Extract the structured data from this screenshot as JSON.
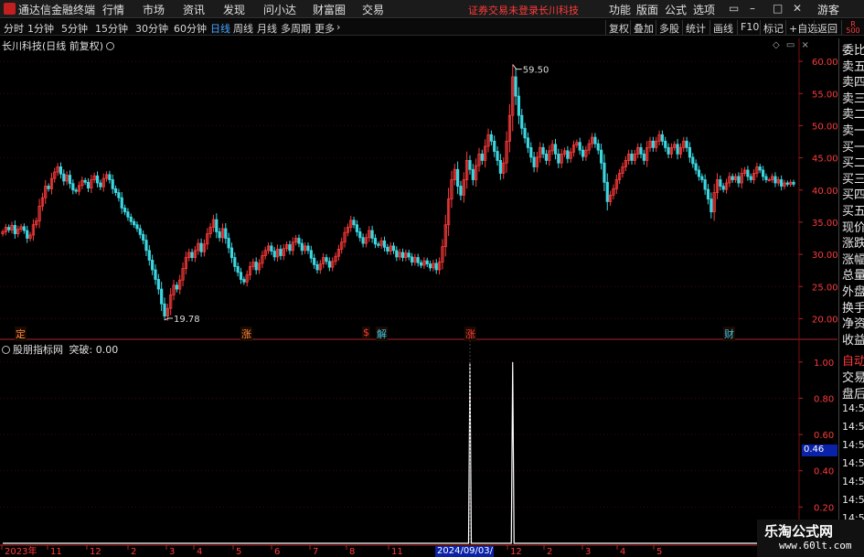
{
  "app": {
    "name": "通达信金融终端",
    "menus": [
      "行情",
      "市场",
      "资讯",
      "发现",
      "问小达",
      "财富圈",
      "交易"
    ],
    "notice": "证券交易未登录",
    "stock_name": "长川科技",
    "right_menus": [
      "功能",
      "版面",
      "公式",
      "选项"
    ],
    "user": "游客"
  },
  "toolbar": {
    "periods": [
      "分时",
      "1分钟",
      "5分钟",
      "15分钟",
      "30分钟",
      "60分钟",
      "日线",
      "周线",
      "月线",
      "多周期",
      "更多"
    ],
    "active_period": "日线",
    "buttons": [
      "复权",
      "叠加",
      "多股",
      "统计",
      "画线",
      "F10",
      "标记",
      "+自选",
      "返回"
    ],
    "r_badge_top": "R",
    "r_badge_bottom": "500"
  },
  "main_chart": {
    "title": "长川科技(日线 前复权)",
    "y_ticks": [
      "60.00",
      "55.00",
      "50.00",
      "45.00",
      "40.00",
      "35.00",
      "30.00",
      "25.00",
      "20.00"
    ],
    "high_label": "59.50",
    "low_label": "19.78",
    "markers": [
      {
        "text": "定",
        "color": "#ff8a3c"
      },
      {
        "text": "涨",
        "color": "#ff8a3c"
      },
      {
        "text": "$",
        "color": "#ff3b3b"
      },
      {
        "text": "解",
        "color": "#3cc6e8"
      },
      {
        "text": "涨",
        "color": "#ff3b3b"
      },
      {
        "text": "财",
        "color": "#3cc6e8"
      }
    ],
    "up_color": "#ff3b3b",
    "down_color": "#3cd6e0"
  },
  "sub_chart": {
    "title": "股朋指标网",
    "indicator_label": "突破: 0.00",
    "y_ticks": [
      "1.00",
      "0.80",
      "0.60",
      "0.40",
      "0.20"
    ],
    "cursor_value": "0.46",
    "line_color": "#ffffff"
  },
  "x_axis": {
    "labels": [
      "2023年",
      "11",
      "12",
      "2",
      "3",
      "4",
      "5",
      "6",
      "7",
      "8",
      "11",
      "12",
      "2",
      "3",
      "4",
      "5"
    ],
    "cursor_date": "2024/09/03/二"
  },
  "right_panel": {
    "items": [
      "委比",
      "卖五",
      "卖四",
      "卖三",
      "卖二",
      "卖一",
      "买一",
      "买二",
      "买三",
      "买四",
      "买五",
      "现价",
      "涨跌",
      "涨幅",
      "总量",
      "外盘",
      "换手",
      "净资",
      "收益"
    ],
    "tabs": [
      "自动",
      "交易",
      "盘后"
    ],
    "times": [
      "14:56",
      "14:56",
      "14:56",
      "14:56",
      "14:56",
      "14:56",
      "14:56",
      "14:56",
      "14:56"
    ]
  },
  "watermark": {
    "title": "乐淘公式网",
    "url": "www.60lt.com"
  },
  "chart_data": {
    "type": "candlestick",
    "title": "长川科技(日线 前复权)",
    "ylim": [
      19,
      61
    ],
    "closes": [
      33.5,
      34.2,
      33.8,
      34.5,
      33.2,
      33.9,
      34.3,
      33.7,
      32.5,
      33.0,
      34.6,
      35.2,
      37.5,
      38.8,
      40.6,
      40.2,
      41.8,
      42.8,
      43.6,
      42.5,
      41.4,
      42.3,
      41.0,
      40.0,
      39.8,
      40.7,
      41.5,
      41.2,
      40.3,
      41.6,
      42.2,
      41.1,
      40.5,
      41.8,
      42.4,
      41.6,
      40.2,
      39.6,
      38.8,
      37.2,
      36.6,
      35.8,
      35.1,
      34.6,
      34.0,
      33.1,
      32.2,
      30.6,
      29.1,
      27.6,
      26.1,
      24.6,
      22.3,
      20.4,
      21.6,
      23.7,
      25.2,
      24.6,
      26.0,
      27.8,
      29.5,
      30.3,
      29.5,
      30.6,
      31.7,
      30.4,
      31.6,
      33.2,
      34.2,
      35.4,
      33.5,
      32.6,
      34.0,
      32.5,
      31.0,
      29.5,
      28.1,
      27.2,
      26.1,
      25.7,
      26.8,
      28.1,
      28.8,
      27.6,
      28.6,
      29.8,
      30.6,
      31.3,
      30.5,
      29.6,
      30.8,
      29.8,
      30.9,
      31.5,
      30.6,
      31.9,
      32.5,
      31.7,
      30.6,
      31.3,
      30.6,
      29.4,
      28.4,
      27.6,
      28.5,
      29.5,
      28.9,
      28.0,
      28.9,
      29.7,
      30.8,
      31.9,
      33.4,
      34.2,
      35.3,
      34.6,
      33.5,
      32.6,
      31.7,
      32.6,
      33.7,
      32.5,
      31.6,
      31.4,
      32.1,
      31.1,
      30.5,
      31.3,
      30.6,
      29.6,
      30.3,
      29.5,
      30.2,
      29.6,
      28.8,
      29.5,
      28.7,
      28.3,
      29.0,
      28.5,
      27.9,
      28.6,
      27.6,
      28.8,
      31.2,
      34.6,
      38.6,
      41.6,
      43.2,
      40.6,
      39.2,
      41.6,
      44.6,
      43.2,
      41.6,
      43.8,
      45.6,
      44.6,
      46.8,
      48.6,
      47.6,
      46.0,
      44.6,
      42.6,
      44.2,
      47.6,
      51.6,
      57.6,
      54.6,
      51.6,
      49.6,
      48.1,
      46.6,
      45.1,
      43.6,
      45.1,
      46.6,
      45.6,
      44.6,
      46.1,
      47.1,
      45.6,
      44.2,
      45.6,
      46.1,
      44.9,
      45.9,
      47.0,
      47.4,
      46.2,
      45.2,
      46.2,
      47.2,
      48.2,
      47.2,
      46.2,
      44.2,
      41.2,
      38.2,
      39.2,
      40.2,
      41.6,
      42.6,
      43.6,
      44.6,
      45.6,
      44.6,
      45.6,
      46.6,
      45.6,
      44.6,
      46.6,
      47.6,
      46.6,
      47.6,
      48.6,
      47.6,
      46.6,
      45.6,
      46.6,
      47.1,
      45.6,
      46.6,
      47.6,
      46.6,
      45.1,
      44.1,
      43.1,
      42.1,
      41.6,
      40.1,
      38.6,
      36.6,
      39.6,
      41.6,
      40.6,
      40.1,
      41.1,
      42.1,
      41.6,
      42.1,
      41.1,
      42.6,
      43.1,
      42.1,
      41.6,
      42.6,
      43.6,
      43.1,
      42.1,
      41.6,
      41.6,
      42.1,
      41.1,
      41.6,
      40.6,
      41.1,
      40.9,
      41.2,
      40.9
    ],
    "high_point": {
      "value": 59.5
    },
    "low_point": {
      "value": 19.78
    }
  }
}
